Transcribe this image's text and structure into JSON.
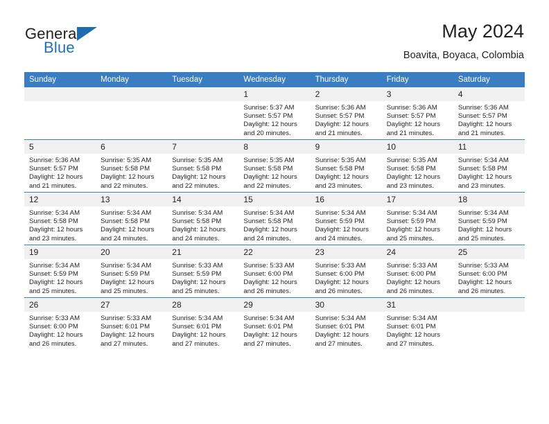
{
  "brand": {
    "name_top": "General",
    "name_bottom": "Blue",
    "accent_color": "#1b6cb0"
  },
  "header": {
    "month_title": "May 2024",
    "location": "Boavita, Boyaca, Colombia"
  },
  "calendar": {
    "header_bg": "#3a7dc0",
    "daynum_bg": "#f0f0f0",
    "weekdays": [
      "Sunday",
      "Monday",
      "Tuesday",
      "Wednesday",
      "Thursday",
      "Friday",
      "Saturday"
    ],
    "weeks": [
      [
        {
          "day": "",
          "lines": []
        },
        {
          "day": "",
          "lines": []
        },
        {
          "day": "",
          "lines": []
        },
        {
          "day": "1",
          "lines": [
            "Sunrise: 5:37 AM",
            "Sunset: 5:57 PM",
            "Daylight: 12 hours",
            "and 20 minutes."
          ]
        },
        {
          "day": "2",
          "lines": [
            "Sunrise: 5:36 AM",
            "Sunset: 5:57 PM",
            "Daylight: 12 hours",
            "and 21 minutes."
          ]
        },
        {
          "day": "3",
          "lines": [
            "Sunrise: 5:36 AM",
            "Sunset: 5:57 PM",
            "Daylight: 12 hours",
            "and 21 minutes."
          ]
        },
        {
          "day": "4",
          "lines": [
            "Sunrise: 5:36 AM",
            "Sunset: 5:57 PM",
            "Daylight: 12 hours",
            "and 21 minutes."
          ]
        }
      ],
      [
        {
          "day": "5",
          "lines": [
            "Sunrise: 5:36 AM",
            "Sunset: 5:57 PM",
            "Daylight: 12 hours",
            "and 21 minutes."
          ]
        },
        {
          "day": "6",
          "lines": [
            "Sunrise: 5:35 AM",
            "Sunset: 5:58 PM",
            "Daylight: 12 hours",
            "and 22 minutes."
          ]
        },
        {
          "day": "7",
          "lines": [
            "Sunrise: 5:35 AM",
            "Sunset: 5:58 PM",
            "Daylight: 12 hours",
            "and 22 minutes."
          ]
        },
        {
          "day": "8",
          "lines": [
            "Sunrise: 5:35 AM",
            "Sunset: 5:58 PM",
            "Daylight: 12 hours",
            "and 22 minutes."
          ]
        },
        {
          "day": "9",
          "lines": [
            "Sunrise: 5:35 AM",
            "Sunset: 5:58 PM",
            "Daylight: 12 hours",
            "and 23 minutes."
          ]
        },
        {
          "day": "10",
          "lines": [
            "Sunrise: 5:35 AM",
            "Sunset: 5:58 PM",
            "Daylight: 12 hours",
            "and 23 minutes."
          ]
        },
        {
          "day": "11",
          "lines": [
            "Sunrise: 5:34 AM",
            "Sunset: 5:58 PM",
            "Daylight: 12 hours",
            "and 23 minutes."
          ]
        }
      ],
      [
        {
          "day": "12",
          "lines": [
            "Sunrise: 5:34 AM",
            "Sunset: 5:58 PM",
            "Daylight: 12 hours",
            "and 23 minutes."
          ]
        },
        {
          "day": "13",
          "lines": [
            "Sunrise: 5:34 AM",
            "Sunset: 5:58 PM",
            "Daylight: 12 hours",
            "and 24 minutes."
          ]
        },
        {
          "day": "14",
          "lines": [
            "Sunrise: 5:34 AM",
            "Sunset: 5:58 PM",
            "Daylight: 12 hours",
            "and 24 minutes."
          ]
        },
        {
          "day": "15",
          "lines": [
            "Sunrise: 5:34 AM",
            "Sunset: 5:58 PM",
            "Daylight: 12 hours",
            "and 24 minutes."
          ]
        },
        {
          "day": "16",
          "lines": [
            "Sunrise: 5:34 AM",
            "Sunset: 5:59 PM",
            "Daylight: 12 hours",
            "and 24 minutes."
          ]
        },
        {
          "day": "17",
          "lines": [
            "Sunrise: 5:34 AM",
            "Sunset: 5:59 PM",
            "Daylight: 12 hours",
            "and 25 minutes."
          ]
        },
        {
          "day": "18",
          "lines": [
            "Sunrise: 5:34 AM",
            "Sunset: 5:59 PM",
            "Daylight: 12 hours",
            "and 25 minutes."
          ]
        }
      ],
      [
        {
          "day": "19",
          "lines": [
            "Sunrise: 5:34 AM",
            "Sunset: 5:59 PM",
            "Daylight: 12 hours",
            "and 25 minutes."
          ]
        },
        {
          "day": "20",
          "lines": [
            "Sunrise: 5:34 AM",
            "Sunset: 5:59 PM",
            "Daylight: 12 hours",
            "and 25 minutes."
          ]
        },
        {
          "day": "21",
          "lines": [
            "Sunrise: 5:33 AM",
            "Sunset: 5:59 PM",
            "Daylight: 12 hours",
            "and 25 minutes."
          ]
        },
        {
          "day": "22",
          "lines": [
            "Sunrise: 5:33 AM",
            "Sunset: 6:00 PM",
            "Daylight: 12 hours",
            "and 26 minutes."
          ]
        },
        {
          "day": "23",
          "lines": [
            "Sunrise: 5:33 AM",
            "Sunset: 6:00 PM",
            "Daylight: 12 hours",
            "and 26 minutes."
          ]
        },
        {
          "day": "24",
          "lines": [
            "Sunrise: 5:33 AM",
            "Sunset: 6:00 PM",
            "Daylight: 12 hours",
            "and 26 minutes."
          ]
        },
        {
          "day": "25",
          "lines": [
            "Sunrise: 5:33 AM",
            "Sunset: 6:00 PM",
            "Daylight: 12 hours",
            "and 26 minutes."
          ]
        }
      ],
      [
        {
          "day": "26",
          "lines": [
            "Sunrise: 5:33 AM",
            "Sunset: 6:00 PM",
            "Daylight: 12 hours",
            "and 26 minutes."
          ]
        },
        {
          "day": "27",
          "lines": [
            "Sunrise: 5:33 AM",
            "Sunset: 6:01 PM",
            "Daylight: 12 hours",
            "and 27 minutes."
          ]
        },
        {
          "day": "28",
          "lines": [
            "Sunrise: 5:34 AM",
            "Sunset: 6:01 PM",
            "Daylight: 12 hours",
            "and 27 minutes."
          ]
        },
        {
          "day": "29",
          "lines": [
            "Sunrise: 5:34 AM",
            "Sunset: 6:01 PM",
            "Daylight: 12 hours",
            "and 27 minutes."
          ]
        },
        {
          "day": "30",
          "lines": [
            "Sunrise: 5:34 AM",
            "Sunset: 6:01 PM",
            "Daylight: 12 hours",
            "and 27 minutes."
          ]
        },
        {
          "day": "31",
          "lines": [
            "Sunrise: 5:34 AM",
            "Sunset: 6:01 PM",
            "Daylight: 12 hours",
            "and 27 minutes."
          ]
        },
        {
          "day": "",
          "lines": []
        }
      ]
    ]
  }
}
